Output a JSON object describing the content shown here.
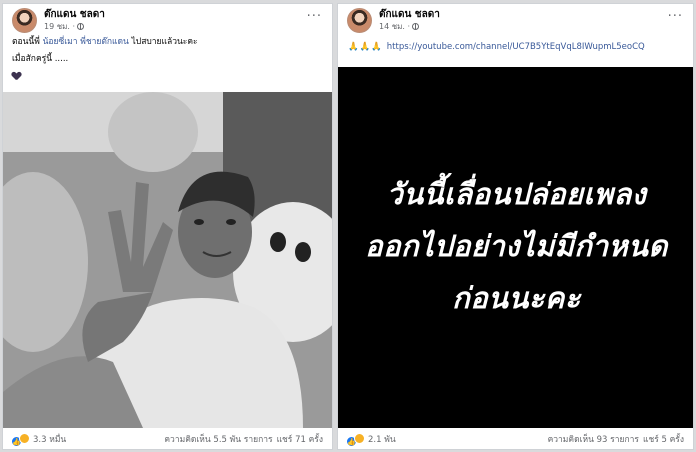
{
  "left_post": {
    "author": "ต๊กแดน ชลดา",
    "time": "19 ชม. ·",
    "line1_prefix": "ตอนนี้พี่ ",
    "mention1": "น้อยซี่เมา",
    "mention2": "พี่ชายต๊กแดน",
    "line1_suffix": " ไปสบายแล้วนะคะ",
    "line2": "เมื่อสักครู่นี้ .....",
    "reaction_count": "3.3 หมื่น",
    "comments": "ความคิดเห็น 5.5 พัน รายการ",
    "shares": "แชร์ 71 ครั้ง"
  },
  "right_post": {
    "author": "ต๊กแดน ชลดา",
    "time": "14 ชม. ·",
    "link_emoji": "🙏🙏🙏",
    "link_url": "https://youtube.com/channel/UC7B5YtEqVqL8IWupmL5eoCQ",
    "overlay_line1": "วันนี้เลื่อนปล่อยเพลง",
    "overlay_line2": "ออกไปอย่างไม่มีกำหนด",
    "overlay_line3": "ก่อนนะคะ",
    "reaction_count": "2.1 พัน",
    "comments": "ความคิดเห็น 93 รายการ",
    "shares": "แชร์ 5 ครั้ง"
  },
  "icons": {
    "more": "···",
    "like": "👍"
  }
}
